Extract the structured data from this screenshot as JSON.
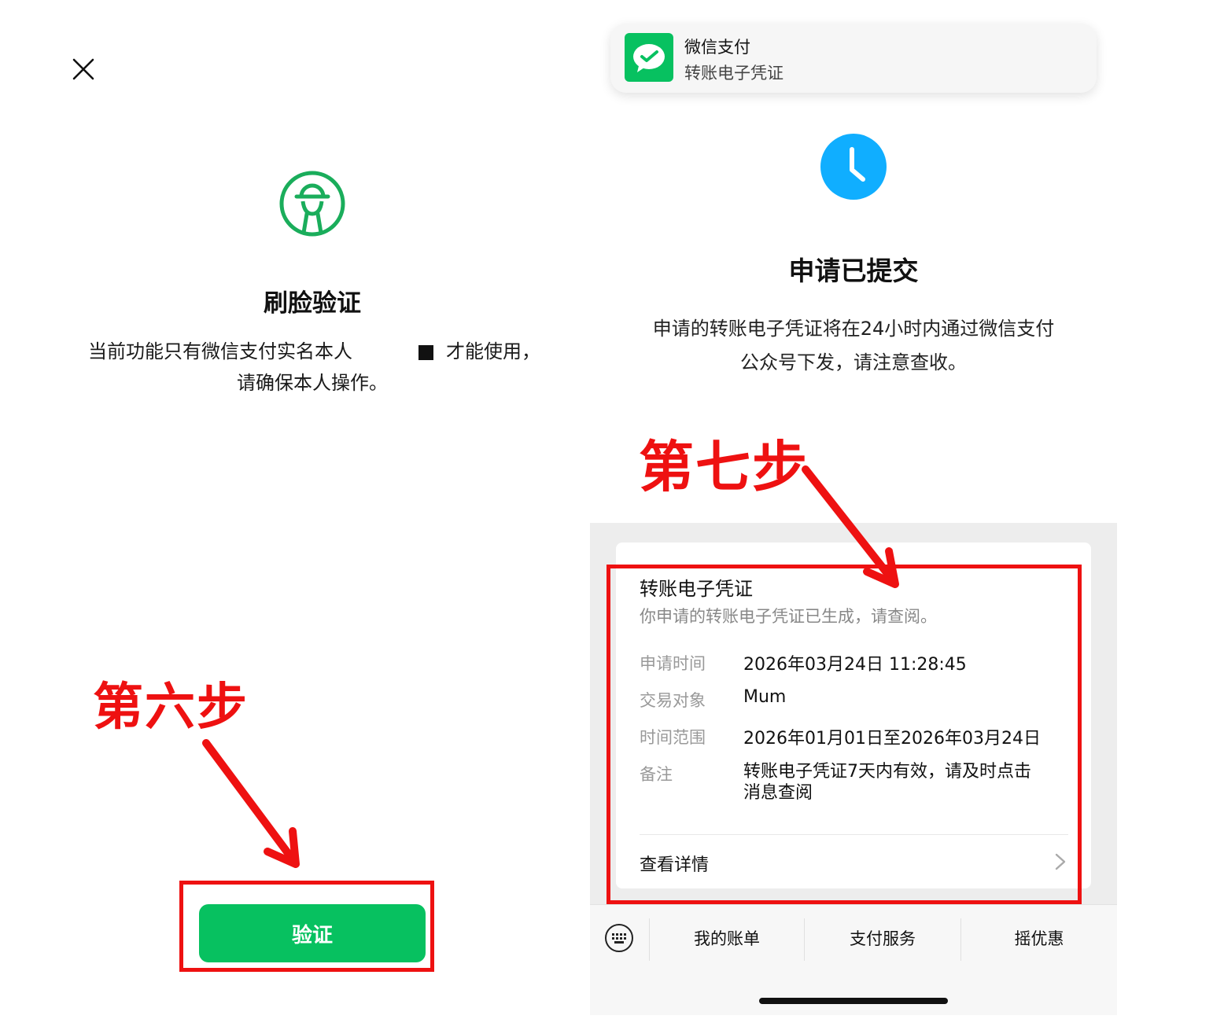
{
  "left_screen": {
    "title": "刷脸验证",
    "description_line1_part1": "当前功能只有微信支付实名本人",
    "description_line1_part2": "才能使用，",
    "description_line2": "请确保本人操作。",
    "verify_button_label": "验证",
    "step_annotation": "第六步"
  },
  "right_screen": {
    "notification": {
      "app_name": "微信支付",
      "message": "转账电子凭证"
    },
    "status_title": "申请已提交",
    "status_desc_line1": "申请的转账电子凭证将在24小时内通过微信支付",
    "status_desc_line2": "公众号下发，请注意查收。",
    "step_annotation": "第七步",
    "card": {
      "title": "转账电子凭证",
      "subtitle": "你申请的转账电子凭证已生成，请查阅。",
      "rows": [
        {
          "label": "申请时间",
          "value": "2026年03月24日 11:28:45"
        },
        {
          "label": "交易对象",
          "value": "Mum"
        },
        {
          "label": "时间范围",
          "value": "2026年01月01日至2026年03月24日"
        },
        {
          "label": "备注",
          "value_line1": "转账电子凭证7天内有效，请及时点击",
          "value_line2": "消息查阅"
        }
      ],
      "detail_link": "查看详情"
    },
    "menu": [
      "我的账单",
      "支付服务",
      "摇优惠"
    ]
  },
  "colors": {
    "wechat_green": "#07c160",
    "clock_blue": "#10aeff",
    "annotation_red": "#ee1111"
  },
  "icons": [
    "close-icon",
    "face-verify-icon",
    "wechat-pay-icon",
    "clock-icon",
    "chevron-right-icon",
    "keyboard-icon"
  ]
}
